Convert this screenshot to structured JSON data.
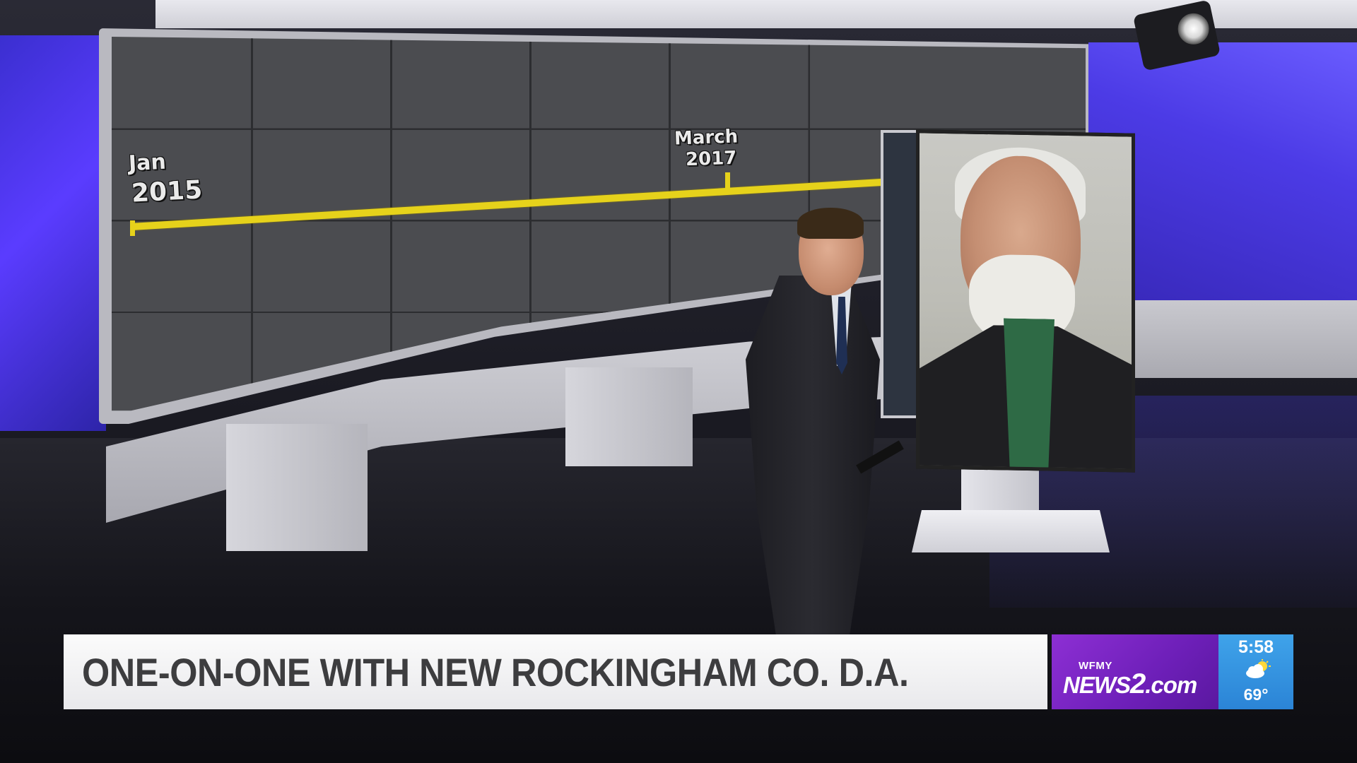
{
  "timeline": {
    "start_month": "Jan",
    "start_year": "2015",
    "mid_month": "March",
    "mid_year": "2017",
    "line_color": "#e6d21b"
  },
  "lower_third": {
    "headline": "ONE-ON-ONE WITH NEW ROCKINGHAM CO. D.A."
  },
  "brand": {
    "call_letters": "WFMY",
    "name_prefix": "NEWS",
    "name_number": "2",
    "name_suffix": ".com",
    "color": "#7a24c2"
  },
  "weather": {
    "time": "5:58",
    "icon": "partly-cloudy-icon",
    "temperature": "69°",
    "color": "#3396e0"
  },
  "studio": {
    "wall_accent": "#4c3be6"
  }
}
